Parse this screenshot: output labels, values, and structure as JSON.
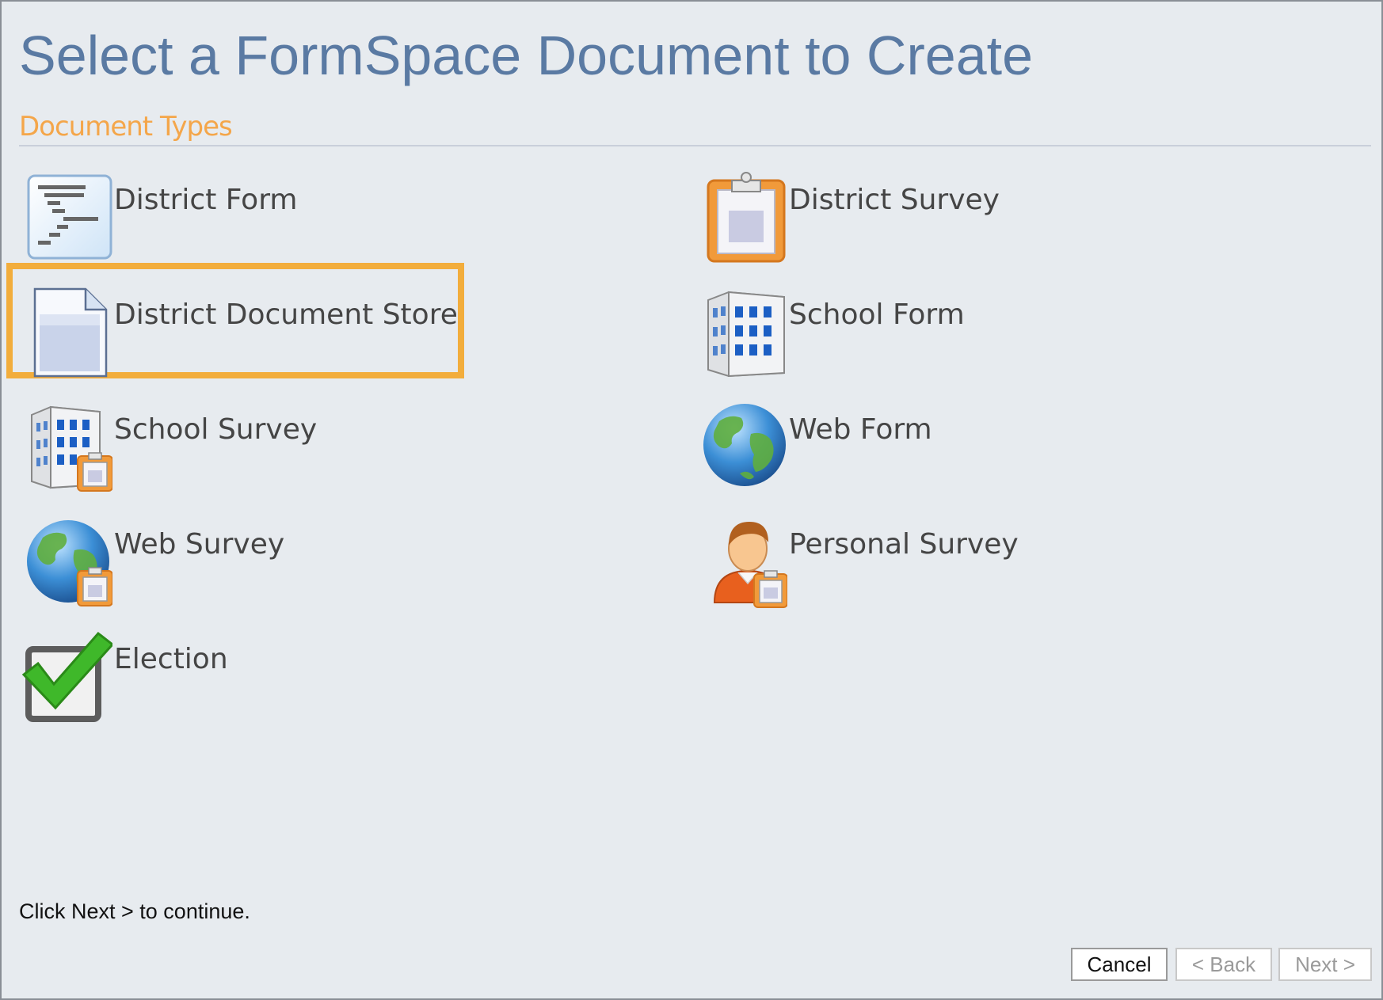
{
  "page": {
    "title": "Select a FormSpace Document to Create",
    "section_title": "Document Types"
  },
  "document_types": [
    {
      "label": "District Form",
      "icon": "district-form-icon"
    },
    {
      "label": "District Survey",
      "icon": "clipboard-icon"
    },
    {
      "label": "District Document Store",
      "icon": "document-icon",
      "selected": true
    },
    {
      "label": "School Form",
      "icon": "building-icon"
    },
    {
      "label": "School Survey",
      "icon": "building-clipboard-icon"
    },
    {
      "label": "Web Form",
      "icon": "globe-icon"
    },
    {
      "label": "Web Survey",
      "icon": "globe-clipboard-icon"
    },
    {
      "label": "Personal Survey",
      "icon": "person-clipboard-icon"
    },
    {
      "label": "Election",
      "icon": "checkbox-check-icon"
    }
  ],
  "footer": {
    "hint": "Click Next > to continue.",
    "cancel_label": "Cancel",
    "back_label": "< Back",
    "next_label": "Next >"
  },
  "colors": {
    "title": "#5a7aa3",
    "section_title": "#f4a64a",
    "selection_border": "#f2ad3c",
    "background": "#e7ebef"
  }
}
